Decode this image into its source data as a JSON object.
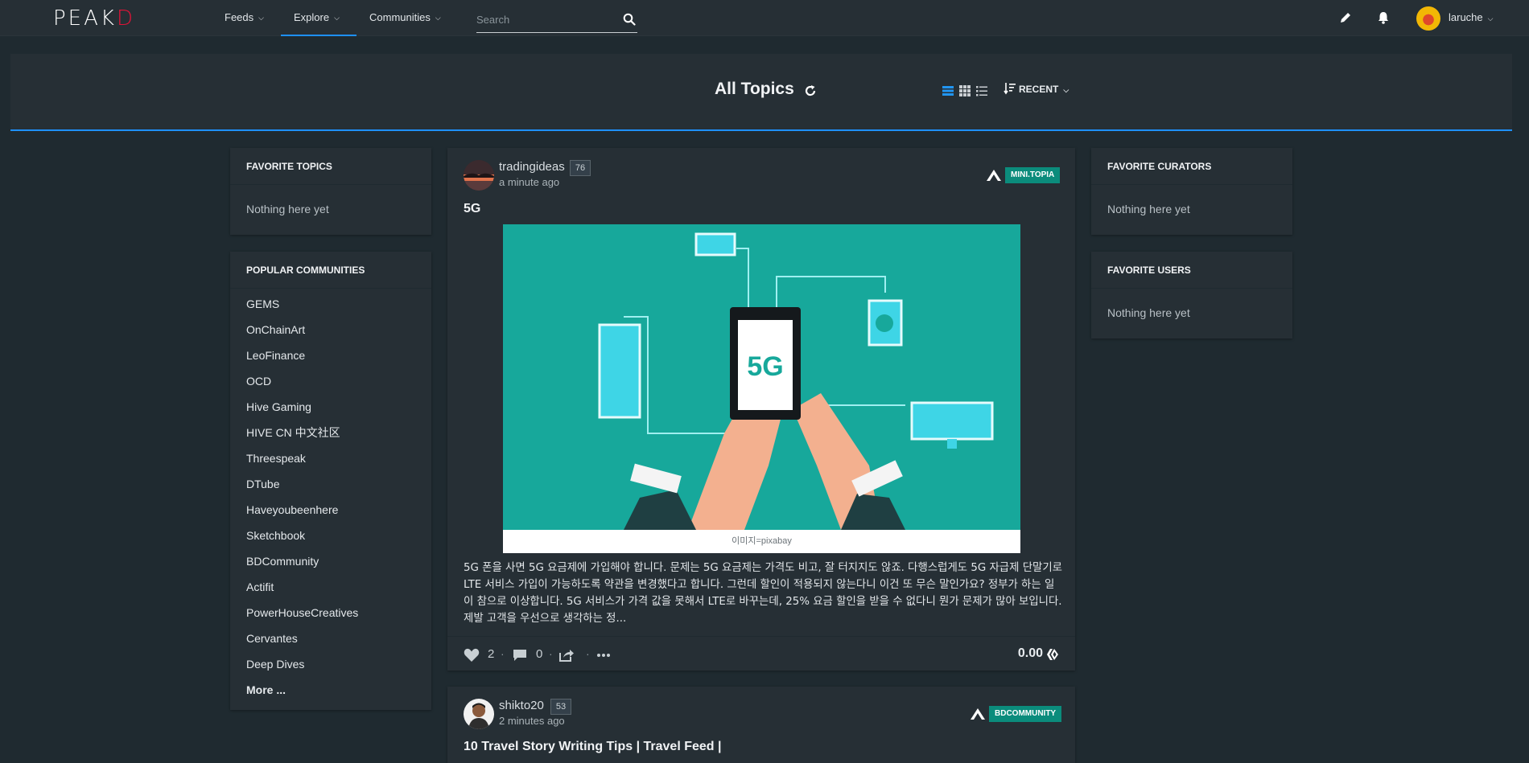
{
  "nav": {
    "logo_main": "PEAK",
    "logo_accent": "D",
    "items": [
      {
        "label": "Feeds"
      },
      {
        "label": "Explore"
      },
      {
        "label": "Communities"
      }
    ],
    "search_placeholder": "Search",
    "user": {
      "name": "laruche"
    },
    "icons": [
      "pencil-icon",
      "bell-icon",
      "chevron-down-icon"
    ],
    "accent_color": "#1e90ff",
    "brand_color": "#e31337"
  },
  "topics": {
    "title": "All Topics",
    "sort_label": "RECENT"
  },
  "left": {
    "favorite_topics": {
      "title": "FAVORITE TOPICS",
      "empty": "Nothing here yet"
    },
    "popular_communities": {
      "title": "POPULAR COMMUNITIES",
      "items": [
        "GEMS",
        "OnChainArt",
        "LeoFinance",
        "OCD",
        "Hive Gaming",
        "HIVE CN 中文社区",
        "Threespeak",
        "DTube",
        "Haveyoubeenhere",
        "Sketchbook",
        "BDCommunity",
        "Actifit",
        "PowerHouseCreatives",
        "Cervantes",
        "Deep Dives"
      ],
      "more": "More ..."
    }
  },
  "right": {
    "favorite_curators": {
      "title": "FAVORITE CURATORS",
      "empty": "Nothing here yet"
    },
    "favorite_users": {
      "title": "FAVORITE USERS",
      "empty": "Nothing here yet"
    }
  },
  "posts": [
    {
      "author": "tradingideas",
      "reputation": "76",
      "time": "a minute ago",
      "community": "MINI.TOPIA",
      "title": "5G",
      "image_label": "5G",
      "image_caption": "이미지=pixabay",
      "body": "5G 폰을 사면 5G 요금제에 가입해야 합니다. 문제는 5G 요금제는 가격도 비고, 잘 터지지도 않죠. 다행스럽게도 5G 자급제 단말기로 LTE 서비스 가입이 가능하도록 약관을 변경했다고 합니다. 그런데 할인이 적용되지 않는다니 이건 또 무슨 말인가요? 정부가 하는 일이 참으로 이상합니다. 5G 서비스가 가격 값을 못해서 LTE로 바꾸는데, 25% 요금 할인을 받을 수 없다니 뭔가 문제가 많아 보입니다. 제발 고객을 우선으로 생각하는 정...",
      "votes": "2",
      "comments": "0",
      "payout": "0.00"
    },
    {
      "author": "shikto20",
      "reputation": "53",
      "time": "2 minutes ago",
      "community": "BDCOMMUNITY",
      "title": "10 Travel Story Writing Tips | Travel Feed |"
    }
  ]
}
